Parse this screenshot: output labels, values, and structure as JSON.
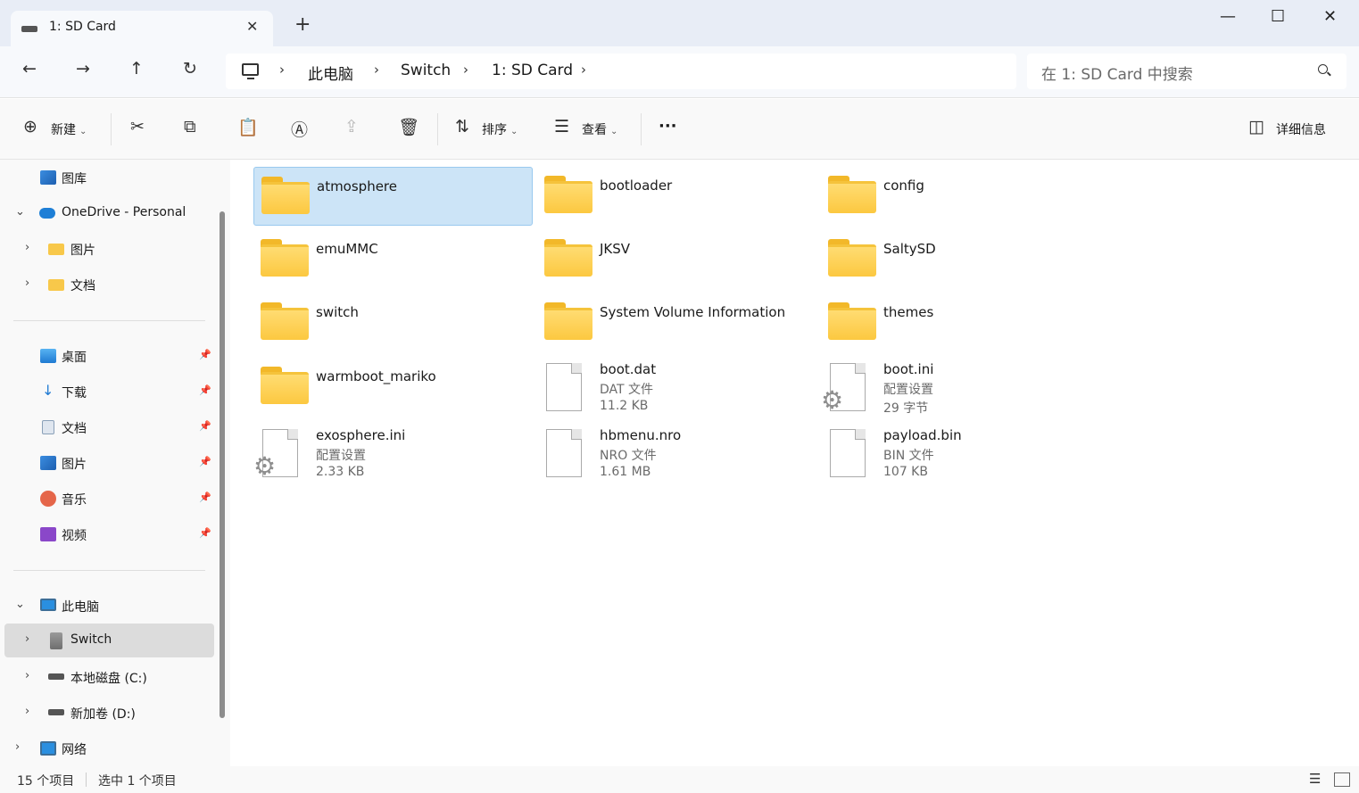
{
  "tab": {
    "title": "1: SD Card",
    "new_tab": "+"
  },
  "window_controls": {
    "minimize": "—",
    "maximize": "☐",
    "close": "✕"
  },
  "nav": {
    "back": "←",
    "forward": "→",
    "up": "↑",
    "refresh": "↻"
  },
  "breadcrumb": [
    "此电脑",
    "Switch",
    "1: SD Card"
  ],
  "search": {
    "placeholder": "在 1: SD Card 中搜索"
  },
  "toolbar": {
    "new_label": "新建",
    "sort_label": "排序",
    "view_label": "查看",
    "more_label": "···",
    "details_label": "详细信息"
  },
  "sidebar": {
    "top": [
      {
        "label": "图库"
      },
      {
        "label": "OneDrive - Personal"
      },
      {
        "label": "图片"
      },
      {
        "label": "文档"
      }
    ],
    "quick": [
      {
        "label": "桌面"
      },
      {
        "label": "下载"
      },
      {
        "label": "文档"
      },
      {
        "label": "图片"
      },
      {
        "label": "音乐"
      },
      {
        "label": "视频"
      }
    ],
    "devices": [
      {
        "label": "此电脑"
      },
      {
        "label": "Switch"
      },
      {
        "label": "本地磁盘 (C:)"
      },
      {
        "label": "新加卷 (D:)"
      },
      {
        "label": "网络"
      }
    ]
  },
  "folders": [
    {
      "name": "atmosphere"
    },
    {
      "name": "bootloader"
    },
    {
      "name": "config"
    },
    {
      "name": "emuMMC"
    },
    {
      "name": "JKSV"
    },
    {
      "name": "SaltySD"
    },
    {
      "name": "switch"
    },
    {
      "name": "System Volume Information"
    },
    {
      "name": "themes"
    },
    {
      "name": "warmboot_mariko"
    }
  ],
  "files": [
    {
      "name": "boot.dat",
      "type": "DAT 文件",
      "size": "11.2 KB"
    },
    {
      "name": "boot.ini",
      "type": "配置设置",
      "size": "29 字节"
    },
    {
      "name": "exosphere.ini",
      "type": "配置设置",
      "size": "2.33 KB"
    },
    {
      "name": "hbmenu.nro",
      "type": "NRO 文件",
      "size": "1.61 MB"
    },
    {
      "name": "payload.bin",
      "type": "BIN 文件",
      "size": "107 KB"
    }
  ],
  "status": {
    "count": "15 个项目",
    "selected": "选中 1 个项目"
  },
  "colors": {
    "accent": "#0067c0",
    "selection": "#cce4f7",
    "folder": "#fcc840"
  }
}
